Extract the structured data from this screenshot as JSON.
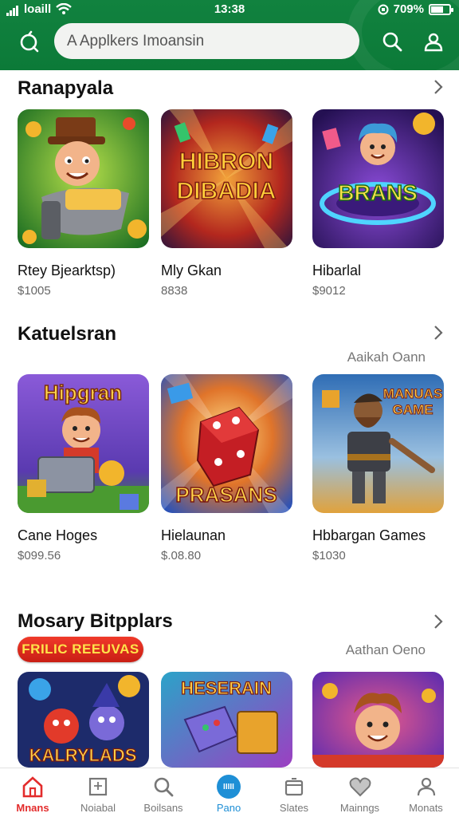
{
  "status_bar": {
    "carrier": "loaill",
    "time": "13:38",
    "battery_text": "709%",
    "battery_level": 0.7
  },
  "search": {
    "placeholder": "A Applkers Imoansin"
  },
  "sections": [
    {
      "title": "Ranapyala",
      "subtitle": "",
      "cards": [
        {
          "name": "Rtey Bjearktsp)",
          "price": "$1005",
          "art_title": "",
          "bg": [
            "#3fa23a",
            "#1b6a1f"
          ]
        },
        {
          "name": "Mly Gkan",
          "price": "8838",
          "art_title": "HIBRON DIBADIA",
          "bg": [
            "#2a1b4d",
            "#b3271e"
          ]
        },
        {
          "name": "Hibarlal",
          "price": "$9012",
          "art_title": "BRANS",
          "bg": [
            "#5a2aa6",
            "#2d1660"
          ]
        }
      ]
    },
    {
      "title": "Katuelsran",
      "subtitle": "Aaikah Oann",
      "cards": [
        {
          "name": "Cane Hoges",
          "price": "$099.56",
          "art_title": "Hipgran",
          "bg": [
            "#7a4ec9",
            "#3d8a2e"
          ]
        },
        {
          "name": "Hielaunan",
          "price": "$.08.80",
          "art_title": "PRASANS",
          "bg": [
            "#2e63c8",
            "#d66d1c"
          ]
        },
        {
          "name": "Hbbargan Games",
          "price": "$1030",
          "art_title": "MANUAS GAME",
          "bg": [
            "#2f6db5",
            "#e0a23c"
          ]
        }
      ]
    },
    {
      "title": "Mosary Bitpplars",
      "subtitle": "Aathan Oeno",
      "badge": "FRILIC REEUVAS",
      "cards": [
        {
          "name": "",
          "price": "",
          "art_title": "KALRYLADS",
          "bg": [
            "#1d2b6b",
            "#c23b2a"
          ]
        },
        {
          "name": "",
          "price": "",
          "art_title": "HESERAIN",
          "bg": [
            "#2ba3c8",
            "#9c3fc2"
          ]
        },
        {
          "name": "",
          "price": "",
          "art_title": "",
          "bg": [
            "#6c3bc2",
            "#c8366f"
          ]
        }
      ]
    }
  ],
  "bottom_nav": [
    {
      "label": "Mnans",
      "icon": "home-icon"
    },
    {
      "label": "Noiabal",
      "icon": "square-icon"
    },
    {
      "label": "Boilsans",
      "icon": "search-icon"
    },
    {
      "label": "Pano",
      "icon": "app-bubble-icon",
      "bubble_text": "IIIII"
    },
    {
      "label": "Slates",
      "icon": "box-icon"
    },
    {
      "label": "Mainngs",
      "icon": "heart-icon"
    },
    {
      "label": "Monats",
      "icon": "person-icon"
    }
  ],
  "colors": {
    "header_green": "#0f7e3b",
    "accent_red": "#e32c2c",
    "accent_blue": "#1e8fd6"
  }
}
